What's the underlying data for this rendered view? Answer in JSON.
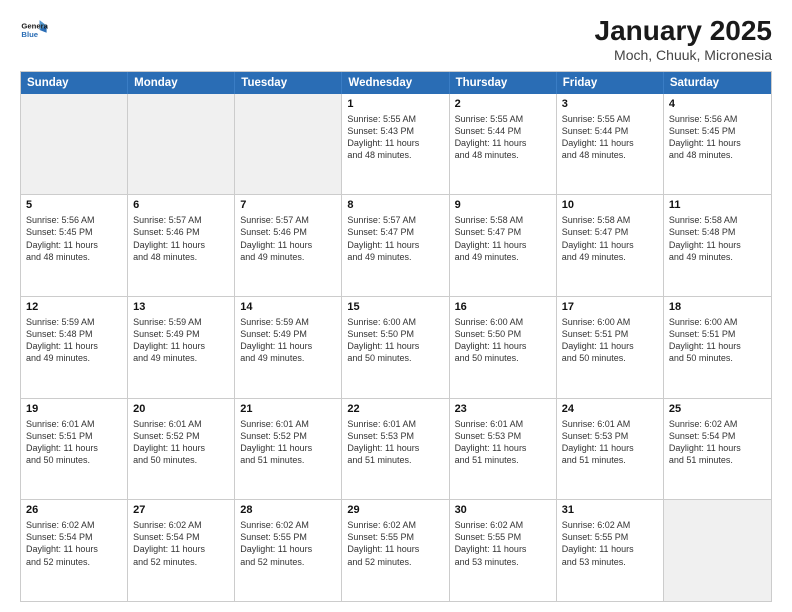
{
  "logo": {
    "line1": "General",
    "line2": "Blue"
  },
  "title": "January 2025",
  "subtitle": "Moch, Chuuk, Micronesia",
  "header_days": [
    "Sunday",
    "Monday",
    "Tuesday",
    "Wednesday",
    "Thursday",
    "Friday",
    "Saturday"
  ],
  "weeks": [
    [
      {
        "day": "",
        "text": "",
        "shaded": true
      },
      {
        "day": "",
        "text": "",
        "shaded": true
      },
      {
        "day": "",
        "text": "",
        "shaded": true
      },
      {
        "day": "1",
        "text": "Sunrise: 5:55 AM\nSunset: 5:43 PM\nDaylight: 11 hours\nand 48 minutes."
      },
      {
        "day": "2",
        "text": "Sunrise: 5:55 AM\nSunset: 5:44 PM\nDaylight: 11 hours\nand 48 minutes."
      },
      {
        "day": "3",
        "text": "Sunrise: 5:55 AM\nSunset: 5:44 PM\nDaylight: 11 hours\nand 48 minutes."
      },
      {
        "day": "4",
        "text": "Sunrise: 5:56 AM\nSunset: 5:45 PM\nDaylight: 11 hours\nand 48 minutes."
      }
    ],
    [
      {
        "day": "5",
        "text": "Sunrise: 5:56 AM\nSunset: 5:45 PM\nDaylight: 11 hours\nand 48 minutes."
      },
      {
        "day": "6",
        "text": "Sunrise: 5:57 AM\nSunset: 5:46 PM\nDaylight: 11 hours\nand 48 minutes."
      },
      {
        "day": "7",
        "text": "Sunrise: 5:57 AM\nSunset: 5:46 PM\nDaylight: 11 hours\nand 49 minutes."
      },
      {
        "day": "8",
        "text": "Sunrise: 5:57 AM\nSunset: 5:47 PM\nDaylight: 11 hours\nand 49 minutes."
      },
      {
        "day": "9",
        "text": "Sunrise: 5:58 AM\nSunset: 5:47 PM\nDaylight: 11 hours\nand 49 minutes."
      },
      {
        "day": "10",
        "text": "Sunrise: 5:58 AM\nSunset: 5:47 PM\nDaylight: 11 hours\nand 49 minutes."
      },
      {
        "day": "11",
        "text": "Sunrise: 5:58 AM\nSunset: 5:48 PM\nDaylight: 11 hours\nand 49 minutes."
      }
    ],
    [
      {
        "day": "12",
        "text": "Sunrise: 5:59 AM\nSunset: 5:48 PM\nDaylight: 11 hours\nand 49 minutes."
      },
      {
        "day": "13",
        "text": "Sunrise: 5:59 AM\nSunset: 5:49 PM\nDaylight: 11 hours\nand 49 minutes."
      },
      {
        "day": "14",
        "text": "Sunrise: 5:59 AM\nSunset: 5:49 PM\nDaylight: 11 hours\nand 49 minutes."
      },
      {
        "day": "15",
        "text": "Sunrise: 6:00 AM\nSunset: 5:50 PM\nDaylight: 11 hours\nand 50 minutes."
      },
      {
        "day": "16",
        "text": "Sunrise: 6:00 AM\nSunset: 5:50 PM\nDaylight: 11 hours\nand 50 minutes."
      },
      {
        "day": "17",
        "text": "Sunrise: 6:00 AM\nSunset: 5:51 PM\nDaylight: 11 hours\nand 50 minutes."
      },
      {
        "day": "18",
        "text": "Sunrise: 6:00 AM\nSunset: 5:51 PM\nDaylight: 11 hours\nand 50 minutes."
      }
    ],
    [
      {
        "day": "19",
        "text": "Sunrise: 6:01 AM\nSunset: 5:51 PM\nDaylight: 11 hours\nand 50 minutes."
      },
      {
        "day": "20",
        "text": "Sunrise: 6:01 AM\nSunset: 5:52 PM\nDaylight: 11 hours\nand 50 minutes."
      },
      {
        "day": "21",
        "text": "Sunrise: 6:01 AM\nSunset: 5:52 PM\nDaylight: 11 hours\nand 51 minutes."
      },
      {
        "day": "22",
        "text": "Sunrise: 6:01 AM\nSunset: 5:53 PM\nDaylight: 11 hours\nand 51 minutes."
      },
      {
        "day": "23",
        "text": "Sunrise: 6:01 AM\nSunset: 5:53 PM\nDaylight: 11 hours\nand 51 minutes."
      },
      {
        "day": "24",
        "text": "Sunrise: 6:01 AM\nSunset: 5:53 PM\nDaylight: 11 hours\nand 51 minutes."
      },
      {
        "day": "25",
        "text": "Sunrise: 6:02 AM\nSunset: 5:54 PM\nDaylight: 11 hours\nand 51 minutes."
      }
    ],
    [
      {
        "day": "26",
        "text": "Sunrise: 6:02 AM\nSunset: 5:54 PM\nDaylight: 11 hours\nand 52 minutes."
      },
      {
        "day": "27",
        "text": "Sunrise: 6:02 AM\nSunset: 5:54 PM\nDaylight: 11 hours\nand 52 minutes."
      },
      {
        "day": "28",
        "text": "Sunrise: 6:02 AM\nSunset: 5:55 PM\nDaylight: 11 hours\nand 52 minutes."
      },
      {
        "day": "29",
        "text": "Sunrise: 6:02 AM\nSunset: 5:55 PM\nDaylight: 11 hours\nand 52 minutes."
      },
      {
        "day": "30",
        "text": "Sunrise: 6:02 AM\nSunset: 5:55 PM\nDaylight: 11 hours\nand 53 minutes."
      },
      {
        "day": "31",
        "text": "Sunrise: 6:02 AM\nSunset: 5:55 PM\nDaylight: 11 hours\nand 53 minutes."
      },
      {
        "day": "",
        "text": "",
        "shaded": true
      }
    ]
  ]
}
